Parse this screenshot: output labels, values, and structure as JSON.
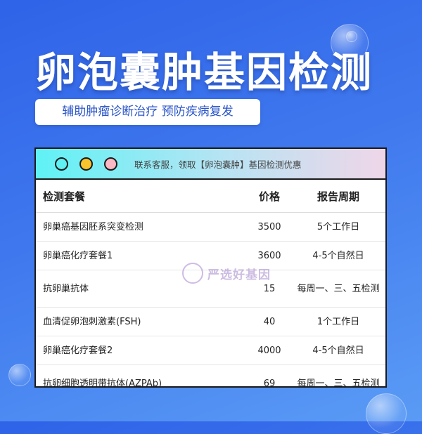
{
  "title": "卵泡囊肿基因检测",
  "subtitle": "辅助肿瘤诊断治疗 预防疾病复发",
  "card": {
    "notice": "联系客服，领取【卵泡囊肿】基因检测优惠",
    "dot_colors": [
      "#5ef0f3",
      "#f7c42b",
      "#f9b8c4"
    ],
    "headers": {
      "package": "检测套餐",
      "price": "价格",
      "period": "报告周期"
    },
    "rows": [
      {
        "name": "卵巢癌基因胚系突变检测",
        "price": "3500",
        "period": "5个工作日"
      },
      {
        "name": "卵巢癌化疗套餐1",
        "price": "3600",
        "period": "4-5个自然日"
      },
      {
        "name": "抗卵巢抗体",
        "price": "15",
        "period": "每周一、三、五检测"
      },
      {
        "name": "血清促卵泡刺激素(FSH)",
        "price": "40",
        "period": "1个工作日"
      },
      {
        "name": "卵巢癌化疗套餐2",
        "price": "4000",
        "period": "4-5个自然日"
      },
      {
        "name": "抗卵细胞透明带抗体(AZPAb)",
        "price": "69",
        "period": "每周一、三、五检测"
      }
    ]
  },
  "watermark": {
    "text": "严选好基因"
  }
}
